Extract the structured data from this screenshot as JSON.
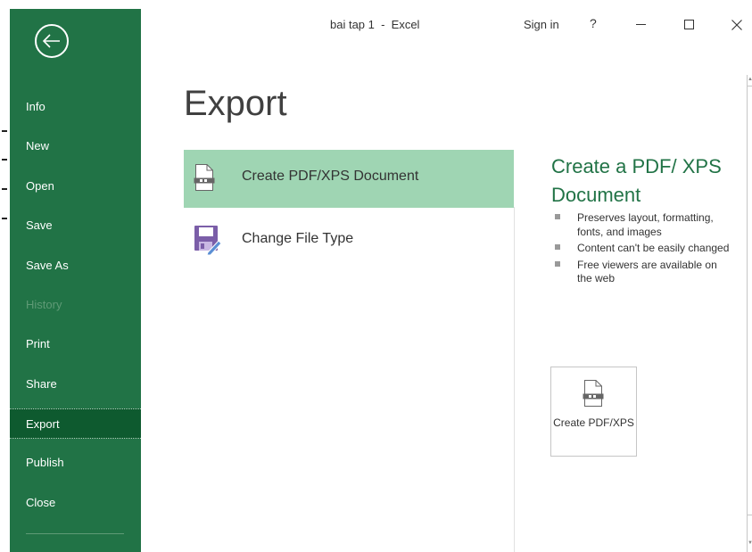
{
  "window": {
    "title": "bai tap 1  -  Excel",
    "sign_in": "Sign in",
    "help": "?"
  },
  "sidebar": {
    "back_icon": "back-arrow-icon",
    "items": [
      {
        "label": "Info",
        "enabled": true
      },
      {
        "label": "New",
        "enabled": true
      },
      {
        "label": "Open",
        "enabled": true
      },
      {
        "label": "Save",
        "enabled": true
      },
      {
        "label": "Save As",
        "enabled": true
      },
      {
        "label": "History",
        "enabled": false
      },
      {
        "label": "Print",
        "enabled": true
      },
      {
        "label": "Share",
        "enabled": true
      },
      {
        "label": "Export",
        "enabled": true,
        "selected": true
      },
      {
        "label": "Publish",
        "enabled": true
      },
      {
        "label": "Close",
        "enabled": true
      }
    ]
  },
  "main": {
    "title": "Export",
    "options": [
      {
        "label": "Create PDF/XPS Document",
        "icon": "pdf-document-icon",
        "selected": true
      },
      {
        "label": "Change File Type",
        "icon": "change-file-type-icon",
        "selected": false
      }
    ],
    "detail": {
      "title": "Create a PDF/ XPS Document",
      "bullets": [
        "Preserves layout, formatting, fonts, and images",
        "Content can't be easily changed",
        "Free viewers are available on the web"
      ],
      "button_label": "Create PDF/XPS"
    }
  },
  "colors": {
    "sidebar_bg": "#217346",
    "sidebar_selected": "#0e5a2f",
    "option_selected": "#9fd5b3",
    "accent_text": "#217346"
  }
}
